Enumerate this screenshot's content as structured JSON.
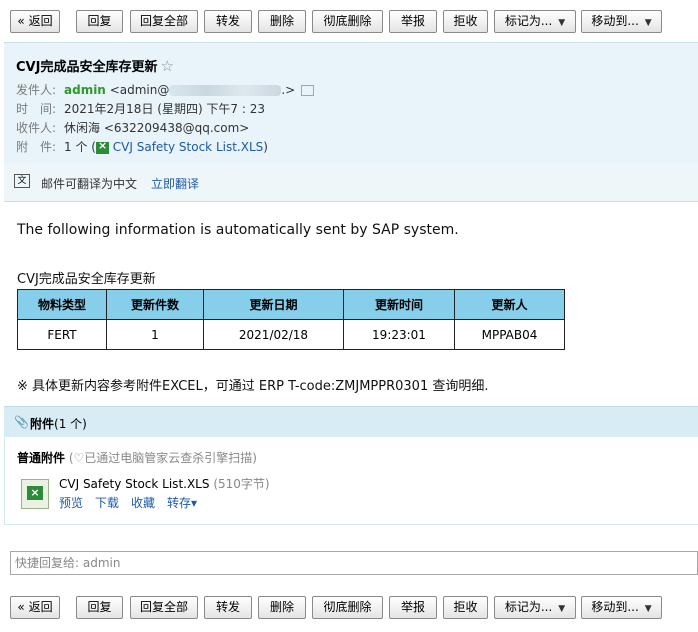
{
  "toolbar": {
    "back": "« 返回",
    "reply": "回复",
    "reply_all": "回复全部",
    "forward": "转发",
    "delete": "删除",
    "delete_permanently": "彻底删除",
    "report": "举报",
    "reject": "拒收",
    "mark_as": "标记为...",
    "move_to": "移动到..."
  },
  "header": {
    "subject": "CVJ完成品安全库存更新",
    "star": "☆",
    "from_label": "发件人:",
    "from_name": "admin",
    "from_addr_prefix": "<admin@",
    "from_addr_suffix": ".>",
    "time_label": "时　间:",
    "time_value": "2021年2月18日 (星期四) 下午7 : 23",
    "to_label": "收件人:",
    "to_value": "休闲海 <632209438@qq.com>",
    "attach_label": "附　件:",
    "attach_count": "1 个 (",
    "attach_name": "CVJ Safety Stock List.XLS",
    "attach_close": ")"
  },
  "translate": {
    "text": "邮件可翻译为中文",
    "link": "立即翻译"
  },
  "body": {
    "intro": "The following information is automatically sent by SAP system.",
    "table_title": "CVJ完成品安全库存更新",
    "table": {
      "columns": [
        "物料类型",
        "更新件数",
        "更新日期",
        "更新时间",
        "更新人"
      ],
      "rows": [
        [
          "FERT",
          "1",
          "2021/02/18",
          "19:23:01",
          "MPPAB04"
        ]
      ]
    },
    "note": "※ 具体更新内容参考附件EXCEL，可通过 ERP T-code:ZMJMPPR0301 查询明细."
  },
  "attachments": {
    "title": "附件",
    "count": "(1 个)",
    "group_label": "普通附件",
    "scan_note": "(♡已通过电脑管家云查杀引擎扫描)",
    "file_name": "CVJ Safety Stock List.XLS",
    "file_size": "(510字节)",
    "preview": "预览",
    "download": "下载",
    "save": "收藏",
    "forward": "转存▾"
  },
  "quick_reply": {
    "placeholder": "快捷回复给: admin"
  }
}
